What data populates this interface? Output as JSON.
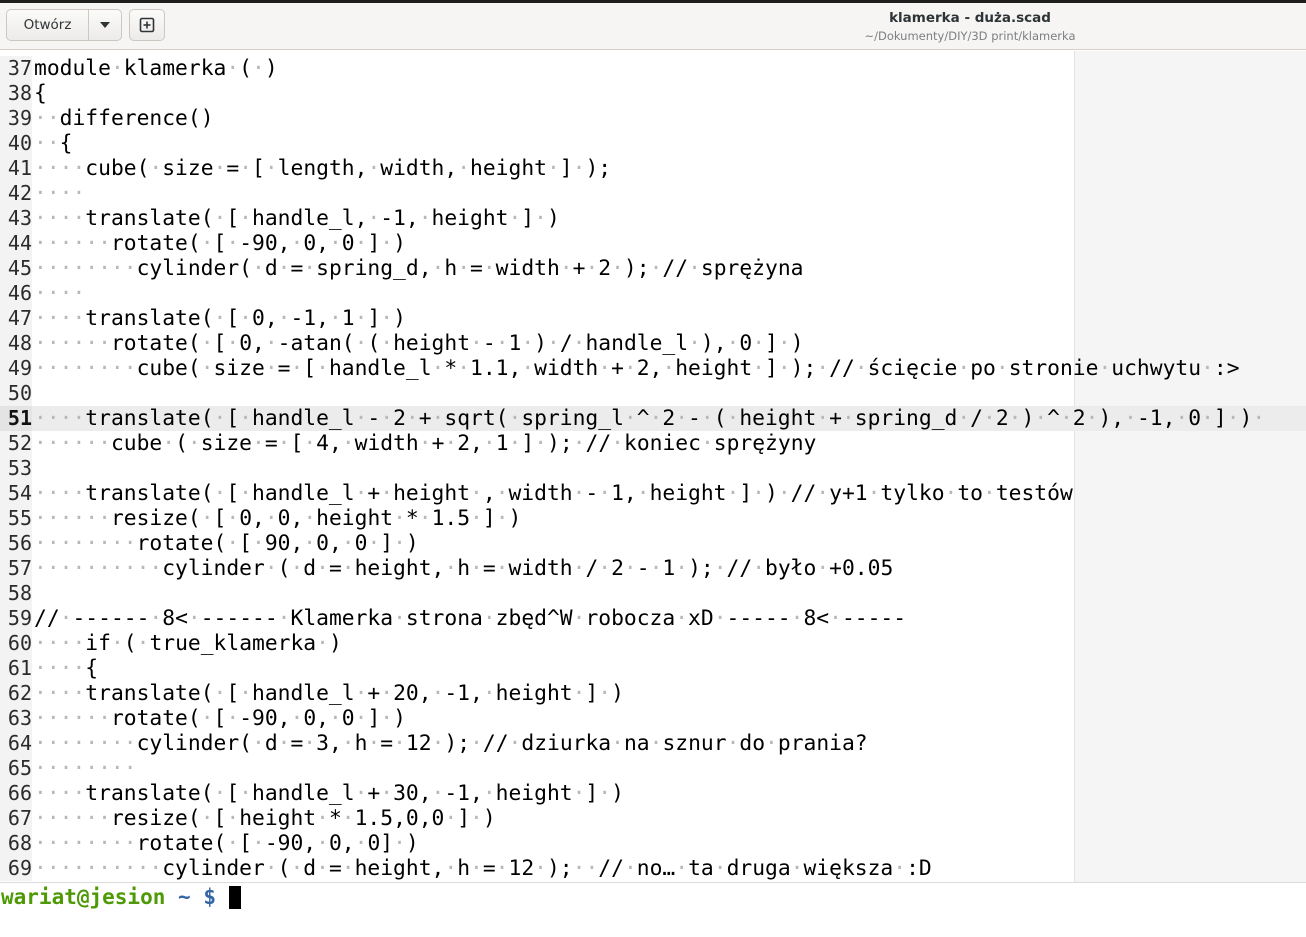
{
  "toolbar": {
    "open_label": "Otwórz",
    "open_menu_icon": "chevron-down-icon",
    "new_tab_icon": "new-document-icon"
  },
  "window": {
    "title": "klamerka - duża.scad",
    "subtitle": "~/Dokumenty/DIY/3D print/klamerka"
  },
  "editor": {
    "current_line": 51,
    "lines": [
      {
        "n": "37",
        "text": "module klamerka ( )"
      },
      {
        "n": "38",
        "text": "{"
      },
      {
        "n": "39",
        "text": "  difference()"
      },
      {
        "n": "40",
        "text": "  {"
      },
      {
        "n": "41",
        "text": "    cube( size = [ length, width, height ] );"
      },
      {
        "n": "42",
        "text": "    "
      },
      {
        "n": "43",
        "text": "    translate( [ handle_l, -1, height ] )"
      },
      {
        "n": "44",
        "text": "      rotate( [ -90, 0, 0 ] )"
      },
      {
        "n": "45",
        "text": "        cylinder( d = spring_d, h = width + 2 ); // sprężyna"
      },
      {
        "n": "46",
        "text": "    "
      },
      {
        "n": "47",
        "text": "    translate( [ 0, -1, 1 ] )"
      },
      {
        "n": "48",
        "text": "      rotate( [ 0, -atan( ( height - 1 ) / handle_l ), 0 ] )"
      },
      {
        "n": "49",
        "text": "        cube( size = [ handle_l * 1.1, width + 2, height ] ); // ścięcie po stronie uchwytu :>"
      },
      {
        "n": "50",
        "text": ""
      },
      {
        "n": "51",
        "text": "    translate( [ handle_l - 2 + sqrt( spring_l ^ 2 - ( height + spring_d / 2 ) ^ 2 ), -1, 0 ] ) "
      },
      {
        "n": "52",
        "text": "      cube ( size = [ 4, width + 2, 1 ] ); // koniec sprężyny"
      },
      {
        "n": "53",
        "text": ""
      },
      {
        "n": "54",
        "text": "    translate( [ handle_l + height , width - 1, height ] ) // y+1 tylko to testów"
      },
      {
        "n": "55",
        "text": "      resize( [ 0, 0, height * 1.5 ] )"
      },
      {
        "n": "56",
        "text": "        rotate( [ 90, 0, 0 ] )"
      },
      {
        "n": "57",
        "text": "          cylinder ( d = height, h = width / 2 - 1 ); // było +0.05"
      },
      {
        "n": "58",
        "text": ""
      },
      {
        "n": "59",
        "text": "// ------ 8< ------ Klamerka strona zbęd^W robocza xD ----- 8< -----"
      },
      {
        "n": "60",
        "text": "    if ( true_klamerka )"
      },
      {
        "n": "61",
        "text": "    {"
      },
      {
        "n": "62",
        "text": "    translate( [ handle_l + 20, -1, height ] )"
      },
      {
        "n": "63",
        "text": "      rotate( [ -90, 0, 0 ] )"
      },
      {
        "n": "64",
        "text": "        cylinder( d = 3, h = 12 ); // dziurka na sznur do prania?"
      },
      {
        "n": "65",
        "text": "        "
      },
      {
        "n": "66",
        "text": "    translate( [ handle_l + 30, -1, height ] )"
      },
      {
        "n": "67",
        "text": "      resize( [ height * 1.5,0,0 ] )"
      },
      {
        "n": "68",
        "text": "        rotate( [ -90, 0, 0] )"
      },
      {
        "n": "69",
        "text": "          cylinder ( d = height, h = 12 );  // no… ta druga większa :D"
      }
    ]
  },
  "terminal": {
    "prompt_user": "wariat@jesion",
    "prompt_path": "~ $",
    "input": ""
  }
}
